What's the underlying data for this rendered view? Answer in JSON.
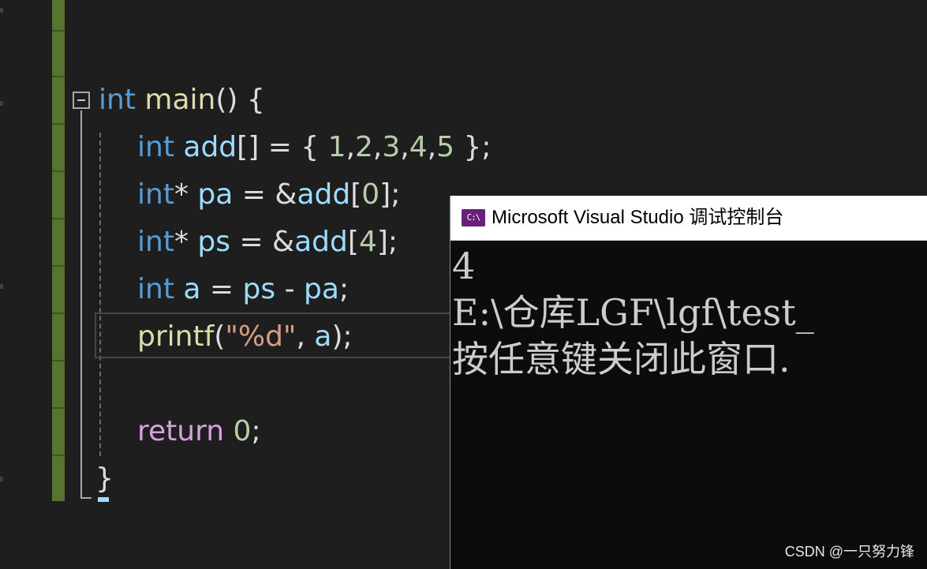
{
  "editor": {
    "lines": [
      {
        "tokens": [
          {
            "t": "int",
            "c": "kw"
          },
          {
            "t": " ",
            "c": "pun"
          },
          {
            "t": "main",
            "c": "fn"
          },
          {
            "t": "() {",
            "c": "pun"
          }
        ]
      },
      {
        "tokens": [
          {
            "t": "int",
            "c": "kw"
          },
          {
            "t": " ",
            "c": "pun"
          },
          {
            "t": "add",
            "c": "var"
          },
          {
            "t": "[] = { ",
            "c": "pun"
          },
          {
            "t": "1",
            "c": "num"
          },
          {
            "t": ",",
            "c": "pun"
          },
          {
            "t": "2",
            "c": "num"
          },
          {
            "t": ",",
            "c": "pun"
          },
          {
            "t": "3",
            "c": "num"
          },
          {
            "t": ",",
            "c": "pun"
          },
          {
            "t": "4",
            "c": "num"
          },
          {
            "t": ",",
            "c": "pun"
          },
          {
            "t": "5",
            "c": "num"
          },
          {
            "t": " };",
            "c": "pun"
          }
        ]
      },
      {
        "tokens": [
          {
            "t": "int",
            "c": "kw"
          },
          {
            "t": "* ",
            "c": "pun"
          },
          {
            "t": "pa",
            "c": "var"
          },
          {
            "t": " = &",
            "c": "pun"
          },
          {
            "t": "add",
            "c": "var"
          },
          {
            "t": "[",
            "c": "pun"
          },
          {
            "t": "0",
            "c": "num"
          },
          {
            "t": "];",
            "c": "pun"
          }
        ]
      },
      {
        "tokens": [
          {
            "t": "int",
            "c": "kw"
          },
          {
            "t": "* ",
            "c": "pun"
          },
          {
            "t": "ps",
            "c": "var"
          },
          {
            "t": " = &",
            "c": "pun"
          },
          {
            "t": "add",
            "c": "var"
          },
          {
            "t": "[",
            "c": "pun"
          },
          {
            "t": "4",
            "c": "num"
          },
          {
            "t": "];",
            "c": "pun"
          }
        ]
      },
      {
        "tokens": [
          {
            "t": "int",
            "c": "kw"
          },
          {
            "t": " ",
            "c": "pun"
          },
          {
            "t": "a",
            "c": "var"
          },
          {
            "t": " = ",
            "c": "pun"
          },
          {
            "t": "ps",
            "c": "var"
          },
          {
            "t": " - ",
            "c": "pun"
          },
          {
            "t": "pa",
            "c": "var"
          },
          {
            "t": ";",
            "c": "pun"
          }
        ]
      },
      {
        "tokens": [
          {
            "t": "printf",
            "c": "fn"
          },
          {
            "t": "(",
            "c": "pun"
          },
          {
            "t": "\"%d\"",
            "c": "str"
          },
          {
            "t": ", ",
            "c": "pun"
          },
          {
            "t": "a",
            "c": "var"
          },
          {
            "t": ");",
            "c": "pun"
          }
        ]
      },
      {
        "tokens": []
      },
      {
        "tokens": [
          {
            "t": "return",
            "c": "ctrl"
          },
          {
            "t": " ",
            "c": "pun"
          },
          {
            "t": "0",
            "c": "num"
          },
          {
            "t": ";",
            "c": "pun"
          }
        ]
      },
      {
        "tokens": [
          {
            "t": "}",
            "c": "pun"
          }
        ]
      }
    ]
  },
  "console": {
    "icon_text": "C:\\",
    "title": "Microsoft Visual Studio 调试控制台",
    "output": [
      "4",
      "E:\\仓库LGF\\lgf\\test_",
      "按任意键关闭此窗口."
    ]
  },
  "watermark": "CSDN @一只努力锋",
  "colors": {
    "editor_bg": "#1e1e1e",
    "keyword": "#569cd6",
    "function": "#dcdcaa",
    "variable": "#9cdcfe",
    "number": "#b5cea8",
    "string": "#d69d85",
    "control": "#d8a0df",
    "change_bar": "#577431",
    "console_bg": "#0c0c0c",
    "console_accent": "#68217a"
  }
}
